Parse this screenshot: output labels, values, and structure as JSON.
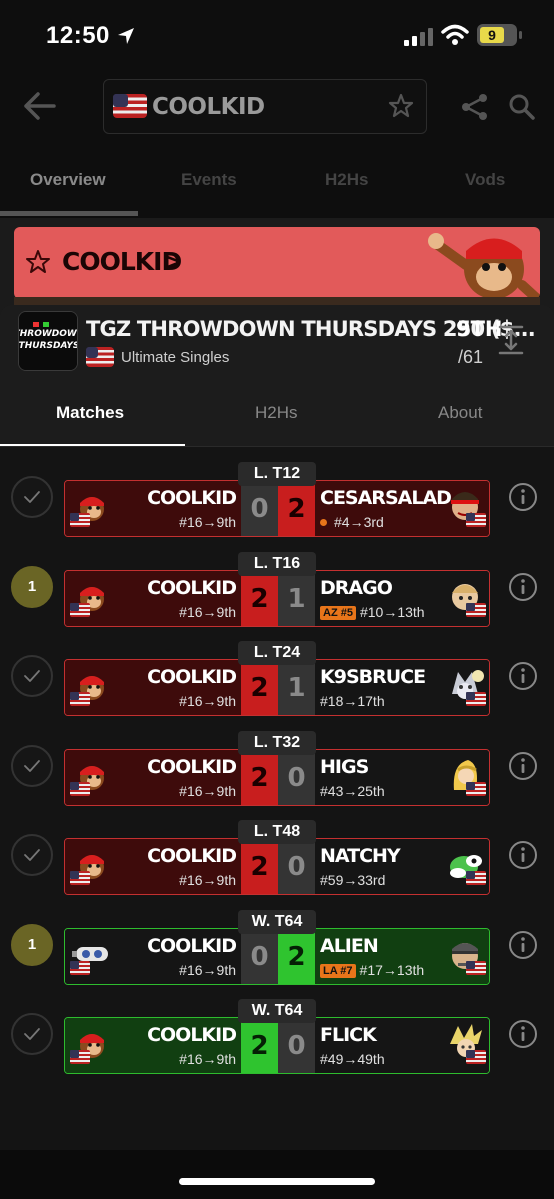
{
  "status_bar": {
    "time": "12:50",
    "battery": "9"
  },
  "header": {
    "player_name": "COOLKID"
  },
  "top_tabs": [
    "Overview",
    "Events",
    "H2Hs",
    "Vods"
  ],
  "banner": {
    "name": "COOLKID",
    "chevron": ">"
  },
  "event": {
    "title": "TGZ THROWDOWN THURSDAYS 250 ($...",
    "type": "Ultimate Singles",
    "placement": "9TH",
    "entrants": "/61",
    "logo_text_1": "THROWDOWN",
    "logo_text_2": "THURSDAYS"
  },
  "sub_tabs": [
    "Matches",
    "H2Hs",
    "About"
  ],
  "matches": [
    {
      "round": "L. T12",
      "status": "check",
      "left_name": "COOLKID",
      "left_seed": "#16→9th",
      "left_score": "0",
      "right_score": "2",
      "right_name": "CESARSALAD",
      "right_seed": "#4→3rd",
      "right_badge": "",
      "outcome": "loss"
    },
    {
      "round": "L. T16",
      "status": "1",
      "left_name": "COOLKID",
      "left_seed": "#16→9th",
      "left_score": "2",
      "right_score": "1",
      "right_name": "DRAGO",
      "right_seed": "#10→13th",
      "right_badge": "AZ #5",
      "outcome": "win"
    },
    {
      "round": "L. T24",
      "status": "check",
      "left_name": "COOLKID",
      "left_seed": "#16→9th",
      "left_score": "2",
      "right_score": "1",
      "right_name": "K9SBRUCE",
      "right_seed": "#18→17th",
      "right_badge": "",
      "outcome": "win"
    },
    {
      "round": "L. T32",
      "status": "check",
      "left_name": "COOLKID",
      "left_seed": "#16→9th",
      "left_score": "2",
      "right_score": "0",
      "right_name": "HIGS",
      "right_seed": "#43→25th",
      "right_badge": "",
      "outcome": "win"
    },
    {
      "round": "L. T48",
      "status": "check",
      "left_name": "COOLKID",
      "left_seed": "#16→9th",
      "left_score": "2",
      "right_score": "0",
      "right_name": "NATCHY",
      "right_seed": "#59→33rd",
      "right_badge": "",
      "outcome": "win"
    },
    {
      "round": "W. T64",
      "status": "1",
      "left_name": "COOLKID",
      "left_seed": "#16→9th",
      "left_score": "0",
      "right_score": "2",
      "right_name": "ALIEN",
      "right_seed": "#17→13th",
      "right_badge": "LA #7",
      "outcome": "loss"
    },
    {
      "round": "W. T64",
      "status": "check",
      "left_name": "COOLKID",
      "left_seed": "#16→9th",
      "left_score": "2",
      "right_score": "0",
      "right_name": "FLICK",
      "right_seed": "#49→49th",
      "right_badge": "",
      "outcome": "win"
    }
  ],
  "colors": {
    "loss_red": "#c81e1e",
    "win_green": "#2fc42f",
    "banner_red": "#e25a5a",
    "badge_orange": "#e8751a"
  }
}
